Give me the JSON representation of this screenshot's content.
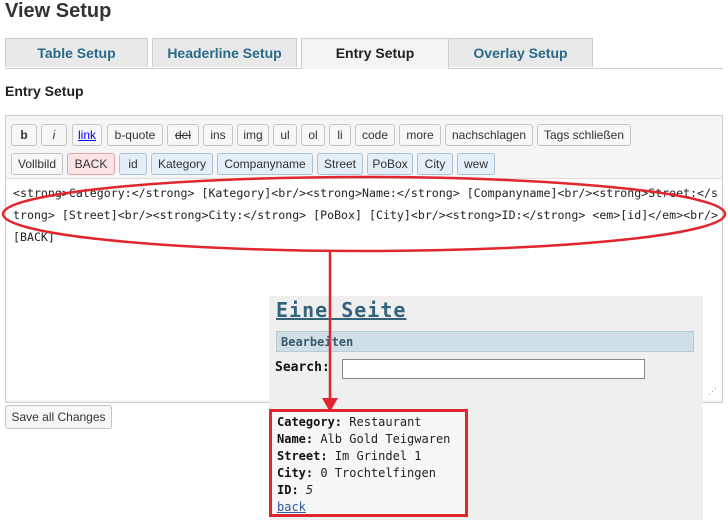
{
  "page_title": "View Setup",
  "tabs": [
    {
      "label": "Table Setup",
      "active": false
    },
    {
      "label": "Headerline Setup",
      "active": false
    },
    {
      "label": "Entry Setup",
      "active": true
    },
    {
      "label": "Overlay Setup",
      "active": false
    }
  ],
  "section_title": "Entry Setup",
  "toolbar": {
    "row1": [
      "b",
      "i",
      "link",
      "b-quote",
      "del",
      "ins",
      "img",
      "ul",
      "ol",
      "li",
      "code",
      "more",
      "nachschlagen",
      "Tags schließen"
    ],
    "row2": [
      "Vollbild",
      "BACK",
      "id",
      "Kategory",
      "Companyname",
      "Street",
      "PoBox",
      "City",
      "wew"
    ]
  },
  "editor": {
    "content": "<strong>Category:</strong> [Kategory]<br/><strong>Name:</strong> [Companyname]<br/><strong>Street:</strong> [Street]<br/><strong>City:</strong> [PoBox] [City]<br/><strong>ID:</strong> <em>[id]</em><br/>[BACK]",
    "resize_grip": "⋰"
  },
  "save_button": "Save all Changes",
  "preview": {
    "title": "Eine Seite",
    "bar": "Bearbeiten",
    "search_label": "Search:",
    "fields": [
      {
        "label": "Category:",
        "value": "Restaurant"
      },
      {
        "label": "Name:",
        "value": "Alb Gold Teigwaren"
      },
      {
        "label": "Street:",
        "value": "Im Grindel 1"
      },
      {
        "label": "City:",
        "value": "0 Trochtelfingen"
      },
      {
        "label": "ID:",
        "value": "5"
      }
    ],
    "back_link": "back"
  },
  "colors": {
    "annotation": "#e0262e",
    "tab_text": "#2a6a8a",
    "preview_title": "#34637c"
  }
}
